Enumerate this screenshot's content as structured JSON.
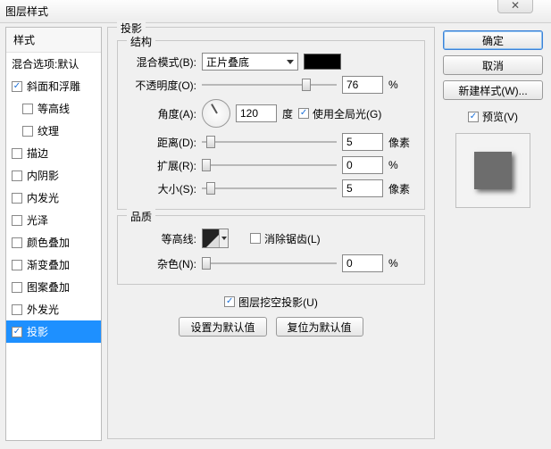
{
  "window": {
    "title": "图层样式",
    "close": "✕"
  },
  "styles": {
    "header": "样式",
    "items": [
      {
        "label": "混合选项:默认",
        "checked": null,
        "sub": false,
        "selected": false
      },
      {
        "label": "斜面和浮雕",
        "checked": true,
        "sub": false,
        "selected": false
      },
      {
        "label": "等高线",
        "checked": false,
        "sub": true,
        "selected": false
      },
      {
        "label": "纹理",
        "checked": false,
        "sub": true,
        "selected": false
      },
      {
        "label": "描边",
        "checked": false,
        "sub": false,
        "selected": false
      },
      {
        "label": "内阴影",
        "checked": false,
        "sub": false,
        "selected": false
      },
      {
        "label": "内发光",
        "checked": false,
        "sub": false,
        "selected": false
      },
      {
        "label": "光泽",
        "checked": false,
        "sub": false,
        "selected": false
      },
      {
        "label": "颜色叠加",
        "checked": false,
        "sub": false,
        "selected": false
      },
      {
        "label": "渐变叠加",
        "checked": false,
        "sub": false,
        "selected": false
      },
      {
        "label": "图案叠加",
        "checked": false,
        "sub": false,
        "selected": false
      },
      {
        "label": "外发光",
        "checked": false,
        "sub": false,
        "selected": false
      },
      {
        "label": "投影",
        "checked": true,
        "sub": false,
        "selected": true
      }
    ]
  },
  "panel": {
    "title": "投影",
    "structure": {
      "legend": "结构",
      "blend_mode_label": "混合模式(B):",
      "blend_mode_value": "正片叠底",
      "color": "#000000",
      "opacity_label": "不透明度(O):",
      "opacity_value": "76",
      "opacity_unit": "%",
      "angle_label": "角度(A):",
      "angle_value": "120",
      "angle_unit": "度",
      "global_light_label": "使用全局光(G)",
      "global_light_checked": true,
      "distance_label": "距离(D):",
      "distance_value": "5",
      "distance_unit": "像素",
      "spread_label": "扩展(R):",
      "spread_value": "0",
      "spread_unit": "%",
      "size_label": "大小(S):",
      "size_value": "5",
      "size_unit": "像素"
    },
    "quality": {
      "legend": "品质",
      "contour_label": "等高线:",
      "antialias_label": "消除锯齿(L)",
      "antialias_checked": false,
      "noise_label": "杂色(N):",
      "noise_value": "0",
      "noise_unit": "%"
    },
    "knockout_label": "图层挖空投影(U)",
    "knockout_checked": true,
    "make_default": "设置为默认值",
    "reset_default": "复位为默认值"
  },
  "buttons": {
    "ok": "确定",
    "cancel": "取消",
    "new_style": "新建样式(W)...",
    "preview_label": "预览(V)",
    "preview_checked": true
  }
}
